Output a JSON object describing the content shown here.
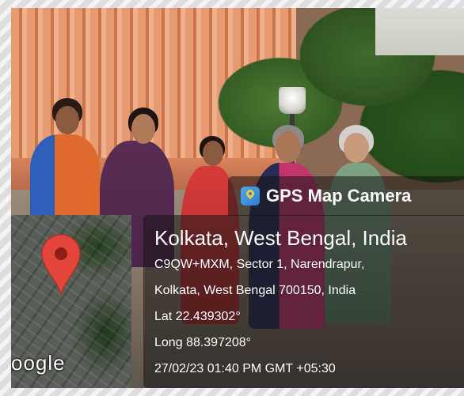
{
  "overlay": {
    "app_name": "GPS Map Camera",
    "city": "Kolkata, West Bengal, India",
    "address_line1": "C9QW+MXM, Sector 1, Narendrapur,",
    "address_line2": "Kolkata, West Bengal 700150, India",
    "latitude": "Lat 22.439302°",
    "longitude": "Long 88.397208°",
    "datetime": "27/02/23 01:40 PM GMT +05:30"
  },
  "map": {
    "google_mark": "oogle"
  },
  "icons": {
    "app": "gps-map-camera-app-icon",
    "pin": "location-pin-icon"
  },
  "colors": {
    "pin": "#e2463a",
    "overlay_bg": "rgba(20,20,20,0.55)",
    "text": "#ffffff"
  }
}
